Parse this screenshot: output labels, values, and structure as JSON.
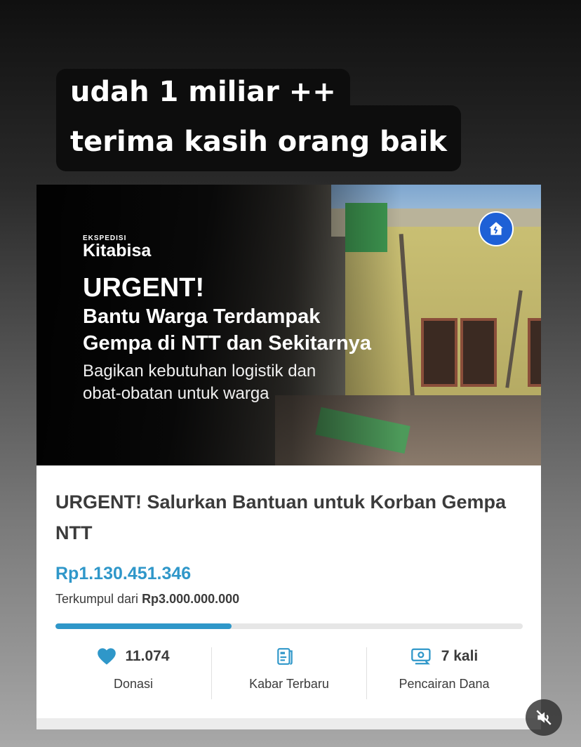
{
  "caption": {
    "line1": "udah 1 miliar ++",
    "line2": "terima kasih orang baik"
  },
  "banner": {
    "brand_small": "EKSPEDISI",
    "brand": "Kitabisa",
    "headline": "URGENT!",
    "subhead_line1": "Bantu Warga Terdampak",
    "subhead_line2": "Gempa di NTT dan Sekitarnya",
    "desc_line1": "Bagikan kebutuhan logistik dan",
    "desc_line2": "obat-obatan untuk warga",
    "badge_icon": "house-crack-icon"
  },
  "campaign": {
    "title": "URGENT! Salurkan Bantuan untuk Korban Gempa NTT",
    "amount": "Rp1.130.451.346",
    "target_prefix": "Terkumpul dari",
    "target_value": "Rp3.000.000.000",
    "progress_fraction": 0.377,
    "accent_color": "#2f97c9"
  },
  "stats": [
    {
      "icon": "heart-icon",
      "value": "11.074",
      "label": "Donasi"
    },
    {
      "icon": "news-icon",
      "value": "",
      "label": "Kabar Terbaru"
    },
    {
      "icon": "disbursement-icon",
      "value": "7 kali",
      "label": "Pencairan Dana"
    }
  ],
  "controls": {
    "mute_icon": "speaker-muted-icon"
  }
}
